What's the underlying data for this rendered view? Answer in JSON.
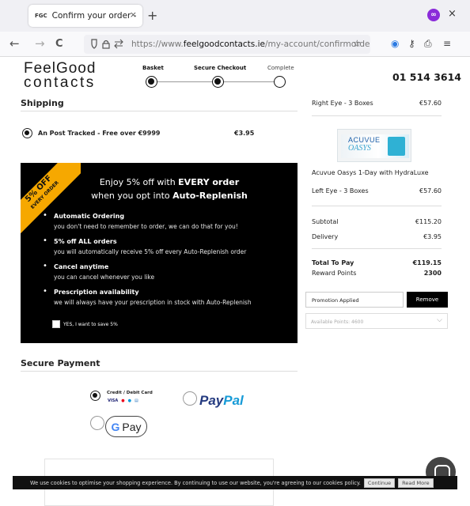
{
  "browser": {
    "tab_title": "Confirm your order - Feel",
    "favicon_text": "FGC",
    "tab_close": "×",
    "new_tab": "+",
    "extension_badge": "∞",
    "window_close": "×",
    "back": "←",
    "forward": "→",
    "reload": "C",
    "url_scheme": "https://www.",
    "url_host": "feelgoodcontacts.ie",
    "url_path": "/my-account/confirmorder",
    "star": "☆",
    "tool_icons": [
      "◉",
      "⚷",
      "⎙",
      "≡"
    ]
  },
  "header": {
    "logo_line1": "FeelGood",
    "logo_line2": "contacts",
    "phone": "01 514 3614",
    "steps": [
      {
        "label": "Basket",
        "state": "done"
      },
      {
        "label": "Secure Checkout",
        "state": "done"
      },
      {
        "label": "Complete",
        "state": "pending"
      }
    ]
  },
  "shipping": {
    "title": "Shipping",
    "option_label": "An Post Tracked - Free over €9999",
    "option_price": "€3.95",
    "selected": true
  },
  "promo": {
    "ribbon_line1": "5% OFF",
    "ribbon_line2": "EVERY ORDER",
    "headline_pre": "Enjoy 5% off with ",
    "headline_bold": "EVERY order",
    "subhead_pre": "when you opt into ",
    "subhead_bold": "Auto-Replenish",
    "benefits": [
      {
        "title": "Automatic Ordering",
        "desc": "you don't need to remember to order, we can do that for you!"
      },
      {
        "title": "5% off ALL orders",
        "desc": "you will automatically receive 5% off every Auto-Replenish order"
      },
      {
        "title": "Cancel anytime",
        "desc": "you can cancel whenever you like"
      },
      {
        "title": "Prescription availability",
        "desc": "we will always have your prescription in stock with Auto-Replenish"
      }
    ],
    "optin_label": "YES, I want to save 5%",
    "ribbon_color": "#f6a800"
  },
  "payment": {
    "title": "Secure Payment",
    "card_label": "Credit / Debit Card",
    "card_brands": [
      "VISA",
      "MC",
      "MAE",
      "AMEX"
    ],
    "paypal_part1": "Pay",
    "paypal_part2": "Pal",
    "gpay_g": "G",
    "gpay_text": "Pay"
  },
  "summary": {
    "right_eye_label": "Right Eye - 3 Boxes",
    "right_eye_price": "€57.60",
    "product_brand": "ACUVUE",
    "product_sub": "OASYS",
    "product_name": "Acuvue Oasys 1-Day with HydraLuxe",
    "left_eye_label": "Left Eye - 3 Boxes",
    "left_eye_price": "€57.60",
    "subtotal_label": "Subtotal",
    "subtotal_value": "€115.20",
    "delivery_label": "Delivery",
    "delivery_value": "€3.95",
    "total_label": "Total To Pay",
    "total_value": "€119.15",
    "reward_label": "Reward Points",
    "reward_value": "2300",
    "promo_applied": "Promotion Applied",
    "remove_label": "Remove",
    "points_placeholder": "Available Points: 4600",
    "chevron": "⌵"
  },
  "cookie": {
    "text": "We use cookies to optimise your shopping experience. By continuing to use our website, you're agreeing to our cookies policy.",
    "continue_label": "Continue",
    "read_more_label": "Read More"
  }
}
